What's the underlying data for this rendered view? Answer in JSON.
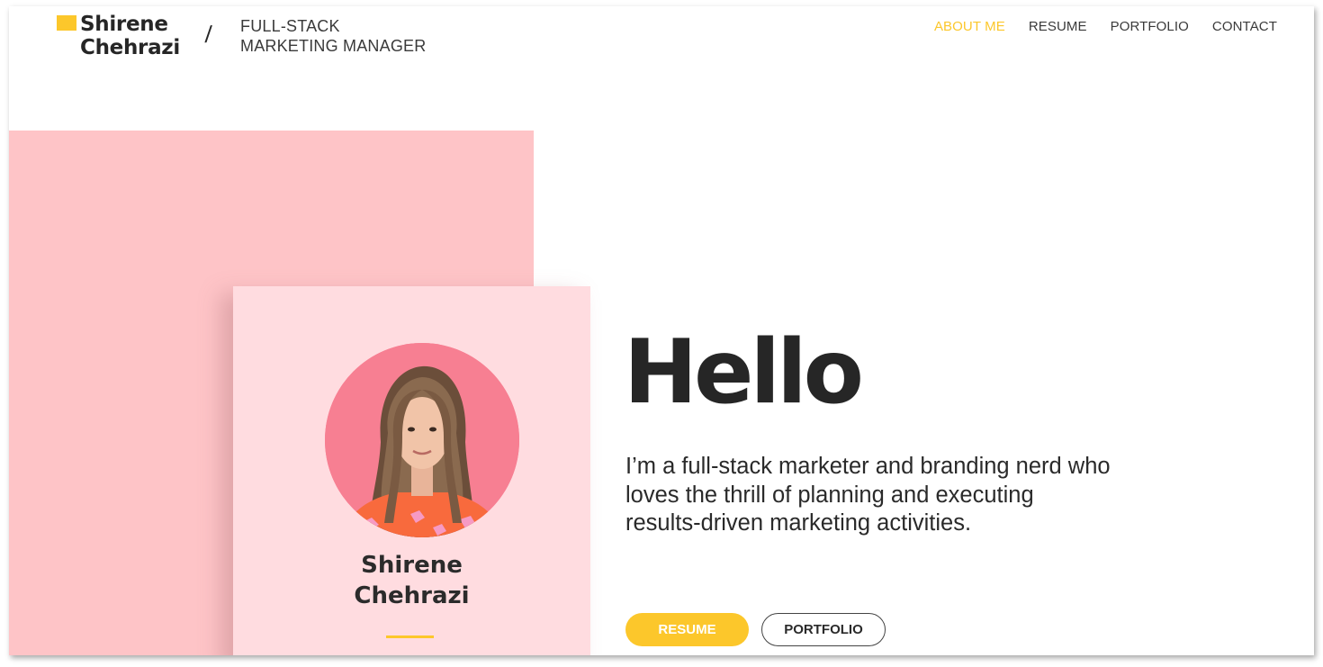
{
  "header": {
    "logo_name_line1": "Shirene",
    "logo_name_line2": "Chehrazi",
    "separator": "/",
    "title_line1": "FULL-STACK",
    "title_line2": "MARKETING MANAGER"
  },
  "nav": {
    "items": [
      {
        "label": "ABOUT ME",
        "active": true
      },
      {
        "label": "RESUME",
        "active": false
      },
      {
        "label": "PORTFOLIO",
        "active": false
      },
      {
        "label": "CONTACT",
        "active": false
      }
    ]
  },
  "profile_card": {
    "name_line1": "Shirene",
    "name_line2": "Chehrazi",
    "photo": "profile-photo"
  },
  "hero": {
    "heading": "Hello",
    "intro": "I’m a full-stack marketer and branding nerd who loves the thrill of planning and executing results-driven marketing activities.",
    "buttons": {
      "resume": "RESUME",
      "portfolio": "PORTFOLIO"
    }
  },
  "colors": {
    "accent": "#fcc72b",
    "pink_block": "#fec4c7",
    "card": "#ffdce0",
    "avatar_bg": "#f77f92",
    "text": "#262626"
  }
}
